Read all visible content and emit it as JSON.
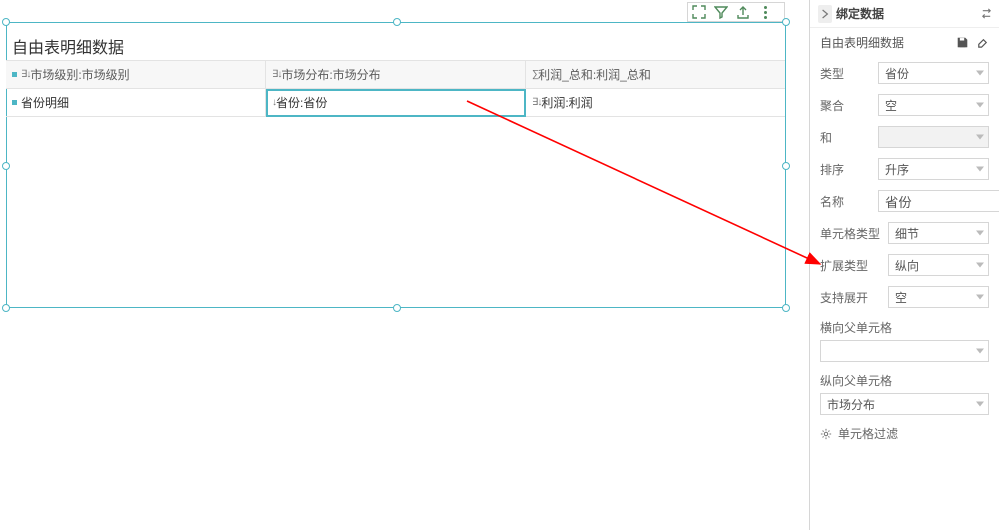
{
  "panel": {
    "title": "自由表明细数据",
    "columns": {
      "a_icon": "list-sort-icon",
      "a_prefix": "∃↓",
      "a": "市场级别:市场级别",
      "b_icon": "list-sort-icon",
      "b_prefix": "∃↓",
      "b": "市场分布:市场分布",
      "c_icon": "sum-icon",
      "c_prefix": "∑",
      "c": "利润_总和:利润_总和"
    },
    "row": {
      "a_icon": "detail-marker-icon",
      "a": "省份明细",
      "b_icon": "sort-down-icon",
      "b_prefix": "↓",
      "b": "省份:省份",
      "c_icon": "list-sort-icon",
      "c_prefix": "∃↓",
      "c": "利润:利润"
    }
  },
  "toolbar": {
    "expand_icon": "expand-icon",
    "filter_icon": "filter-icon",
    "export_icon": "export-icon",
    "more_icon": "more-icon"
  },
  "right": {
    "header": "绑定数据",
    "swap_icon": "swap-icon",
    "data_source": "自由表明细数据",
    "save_icon": "save-icon",
    "erase_icon": "erase-icon",
    "fields": {
      "type_lbl": "类型",
      "type_val": "省份",
      "agg_lbl": "聚合",
      "agg_val": "空",
      "agg2_lbl": "和",
      "agg2_val": "",
      "sort_lbl": "排序",
      "sort_val": "升序",
      "name_lbl": "名称",
      "name_val": "省份",
      "celltype_lbl": "单元格类型",
      "celltype_val": "细节",
      "expandtype_lbl": "扩展类型",
      "expandtype_val": "纵向",
      "support_lbl": "支持展开",
      "support_val": "空",
      "hparent_lbl": "横向父单元格",
      "hparent_val": "",
      "vparent_lbl": "纵向父单元格",
      "vparent_val": "市场分布",
      "filter_lbl": "单元格过滤"
    }
  }
}
